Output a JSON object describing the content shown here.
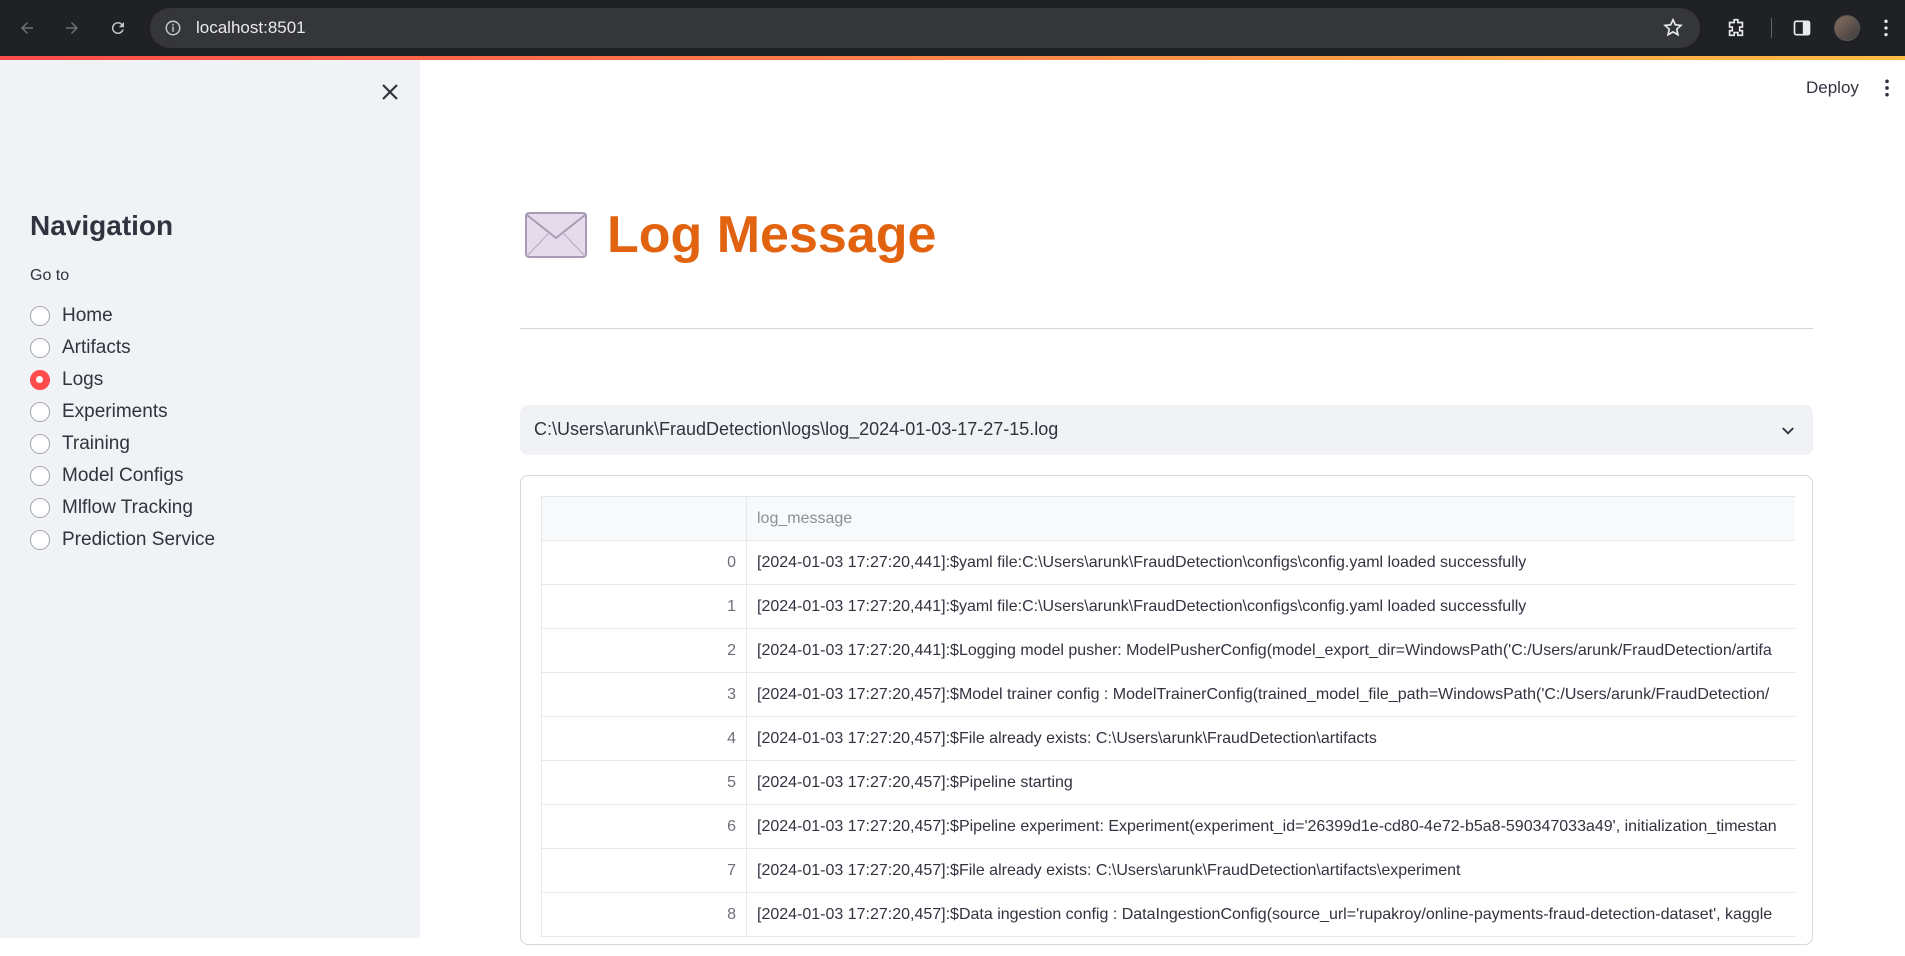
{
  "browser": {
    "url": "localhost:8501"
  },
  "sidebar": {
    "title": "Navigation",
    "goto_label": "Go to",
    "options": [
      {
        "label": "Home",
        "selected": false
      },
      {
        "label": "Artifacts",
        "selected": false
      },
      {
        "label": "Logs",
        "selected": true
      },
      {
        "label": "Experiments",
        "selected": false
      },
      {
        "label": "Training",
        "selected": false
      },
      {
        "label": "Model Configs",
        "selected": false
      },
      {
        "label": "Mlflow Tracking",
        "selected": false
      },
      {
        "label": "Prediction Service",
        "selected": false
      }
    ]
  },
  "header": {
    "deploy_label": "Deploy"
  },
  "main": {
    "title": "Log Message",
    "title_icon": "envelope-icon",
    "selected_file": "C:\\Users\\arunk\\FraudDetection\\logs\\log_2024-01-03-17-27-15.log",
    "table": {
      "columns": [
        "",
        "log_message"
      ],
      "rows": [
        {
          "index": "0",
          "message": "[2024-01-03 17:27:20,441]:$yaml file:C:\\Users\\arunk\\FraudDetection\\configs\\config.yaml loaded successfully"
        },
        {
          "index": "1",
          "message": "[2024-01-03 17:27:20,441]:$yaml file:C:\\Users\\arunk\\FraudDetection\\configs\\config.yaml loaded successfully"
        },
        {
          "index": "2",
          "message": "[2024-01-03 17:27:20,441]:$Logging model pusher: ModelPusherConfig(model_export_dir=WindowsPath('C:/Users/arunk/FraudDetection/artifa"
        },
        {
          "index": "3",
          "message": "[2024-01-03 17:27:20,457]:$Model trainer config : ModelTrainerConfig(trained_model_file_path=WindowsPath('C:/Users/arunk/FraudDetection/"
        },
        {
          "index": "4",
          "message": "[2024-01-03 17:27:20,457]:$File already exists: C:\\Users\\arunk\\FraudDetection\\artifacts"
        },
        {
          "index": "5",
          "message": "[2024-01-03 17:27:20,457]:$Pipeline starting"
        },
        {
          "index": "6",
          "message": "[2024-01-03 17:27:20,457]:$Pipeline experiment: Experiment(experiment_id='26399d1e-cd80-4e72-b5a8-590347033a49', initialization_timestan"
        },
        {
          "index": "7",
          "message": "[2024-01-03 17:27:20,457]:$File already exists: C:\\Users\\arunk\\FraudDetection\\artifacts\\experiment"
        },
        {
          "index": "8",
          "message": "[2024-01-03 17:27:20,457]:$Data ingestion config : DataIngestionConfig(source_url='rupakroy/online-payments-fraud-detection-dataset', kaggle"
        }
      ]
    }
  },
  "colors": {
    "accent": "#ff4b4b",
    "title": "#e2630f",
    "sidebar_bg": "#f0f2f6"
  }
}
